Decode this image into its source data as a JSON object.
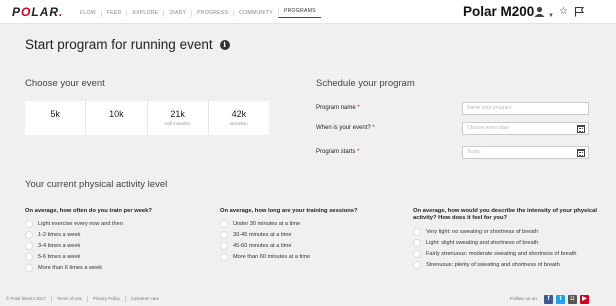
{
  "brand": {
    "logo_text": "POLAR.",
    "accent": "#d6001c"
  },
  "nav": {
    "items": [
      {
        "label": "FLOW"
      },
      {
        "label": "FEED"
      },
      {
        "label": "EXPLORE"
      },
      {
        "label": "DIARY"
      },
      {
        "label": "PROGRESS"
      },
      {
        "label": "COMMUNITY"
      },
      {
        "label": "PROGRAMS",
        "active": true
      }
    ]
  },
  "header": {
    "device": "Polar M200",
    "icons": [
      "user-icon",
      "chevron-down-icon",
      "star-icon",
      "flag-icon"
    ]
  },
  "page": {
    "title": "Start program for running event",
    "info_icon": "i"
  },
  "event_section": {
    "title": "Choose your event",
    "events": [
      {
        "distance": "5k",
        "subtitle": ""
      },
      {
        "distance": "10k",
        "subtitle": ""
      },
      {
        "distance": "21k",
        "subtitle": "Half marathon"
      },
      {
        "distance": "42k",
        "subtitle": "Marathon"
      }
    ]
  },
  "schedule": {
    "title": "Schedule your program",
    "fields": [
      {
        "label": "Program name",
        "required": "*",
        "placeholder": "Name your program"
      },
      {
        "label": "When is your event?",
        "required": "*",
        "placeholder": "Choose event date"
      },
      {
        "label": "Program starts",
        "required": "*",
        "placeholder": "Today"
      }
    ]
  },
  "activity": {
    "title": "Your current physical activity level",
    "questions": [
      {
        "text": "On average, how often do you train per week?",
        "options": [
          "Light exercise every now and then",
          "1-2 times a week",
          "3-4 times a week",
          "5-6 times a week",
          "More than 6 times a week"
        ]
      },
      {
        "text": "On average, how long are your training sessions?",
        "options": [
          "Under 30 minutes at a time",
          "30-45 minutes at a time",
          "45-60 minutes at a time",
          "More than 60 minutes at a time"
        ]
      },
      {
        "text": "On average, how would you describe the intensity of your physical activity? How does it feel for you?",
        "options": [
          "Very light: no sweating or shortness of breath",
          "Light: slight sweating and shortness of breath",
          "Fairly strenuous: moderate sweating and shortness of breath",
          "Strenuous: plenty of sweating and shortness of breath"
        ]
      }
    ]
  },
  "footer": {
    "links": [
      "© Polar Electro 2017",
      "Terms of Use",
      "Privacy Policy",
      "Customer care"
    ],
    "follow_label": "Follow us on",
    "social": [
      {
        "name": "facebook-icon",
        "glyph": "f"
      },
      {
        "name": "twitter-icon",
        "glyph": "t"
      },
      {
        "name": "instagram-icon",
        "glyph": "◘"
      },
      {
        "name": "youtube-icon",
        "glyph": "▶"
      }
    ]
  }
}
